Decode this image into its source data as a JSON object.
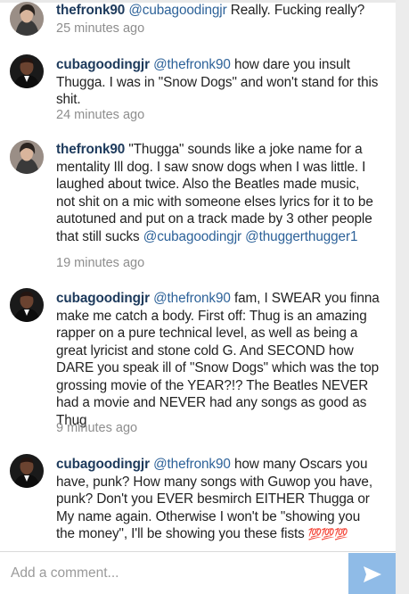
{
  "comments": [
    {
      "username": "thefronk90",
      "parts": [
        {
          "t": "@cubagoodingjr",
          "m": true
        },
        {
          "t": " Really. Fucking really?",
          "m": false
        }
      ],
      "time": "25 minutes ago",
      "avatar": "woman-avatar"
    },
    {
      "username": "cubagoodingjr",
      "parts": [
        {
          "t": "@thefronk90",
          "m": true
        },
        {
          "t": " how dare you insult Thugga. I was in \"Snow Dogs\" and won't stand for this shit.",
          "m": false
        }
      ],
      "time": "24 minutes ago",
      "avatar": "man-avatar"
    },
    {
      "username": "thefronk90",
      "parts": [
        {
          "t": "\"Thugga\" sounds like a joke name for a mentality Ill dog. I saw snow dogs when I was little. I laughed about twice. Also the Beatles made music, not shit on a mic with someone elses lyrics for it to be autotuned and put on a track made by 3 other people that still sucks ",
          "m": false
        },
        {
          "t": "@cubagoodingjr",
          "m": true
        },
        {
          "t": " ",
          "m": false
        },
        {
          "t": "@thuggerthugger1",
          "m": true
        }
      ],
      "time": "19 minutes ago",
      "avatar": "woman-avatar"
    },
    {
      "username": "cubagoodingjr",
      "parts": [
        {
          "t": "@thefronk90",
          "m": true
        },
        {
          "t": " fam, I SWEAR you finna make me catch a body. First off: Thug is an amazing rapper on a pure technical level, as well as being a great lyricist and stone cold G. And SECOND how DARE you speak ill of \"Snow Dogs\" which was the top grossing movie of the YEAR?!? The Beatles NEVER had a movie and NEVER had any songs as good as Thug",
          "m": false
        }
      ],
      "time": "9 minutes ago",
      "avatar": "man-avatar"
    },
    {
      "username": "cubagoodingjr",
      "parts": [
        {
          "t": "@thefronk90",
          "m": true
        },
        {
          "t": " how many Oscars you have, punk? How many songs with Guwop you have, punk? Don't you EVER besmirch EITHER Thugga or My name again. Otherwise I won't be \"showing you the money\", I'll be showing you these fists ",
          "m": false
        }
      ],
      "emoji": "💯💯💯",
      "time": "",
      "avatar": "man-avatar"
    }
  ],
  "composer": {
    "placeholder": "Add a comment...",
    "send_icon": "send-arrow-icon"
  },
  "colors": {
    "username": "#1d3a5c",
    "mention": "#2d6299",
    "timestamp": "#8e8e8e",
    "send_button": "#8fbbe7"
  }
}
